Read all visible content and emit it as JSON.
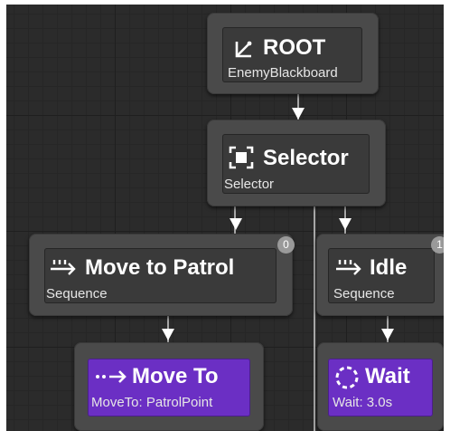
{
  "nodes": {
    "root": {
      "title": "ROOT",
      "subtitle": "EnemyBlackboard",
      "icon": "root-branch-icon"
    },
    "selector": {
      "title": "Selector",
      "subtitle": "Selector",
      "icon": "selector-icon"
    },
    "patrol": {
      "title": "Move to Patrol",
      "subtitle": "Sequence",
      "icon": "sequence-icon",
      "badge": "0"
    },
    "idle": {
      "title": "Idle",
      "subtitle": "Sequence",
      "icon": "sequence-icon",
      "badge": "1"
    },
    "moveto": {
      "title": "Move To",
      "subtitle": "MoveTo: PatrolPoint",
      "icon": "move-to-icon"
    },
    "wait": {
      "title": "Wait",
      "subtitle": "Wait: 3.0s",
      "icon": "wait-icon"
    }
  },
  "colors": {
    "task": "#6b2fc4",
    "composite": "#3a3a3a",
    "node_frame": "#4a4a4a",
    "wire": "#a7a7a7"
  }
}
